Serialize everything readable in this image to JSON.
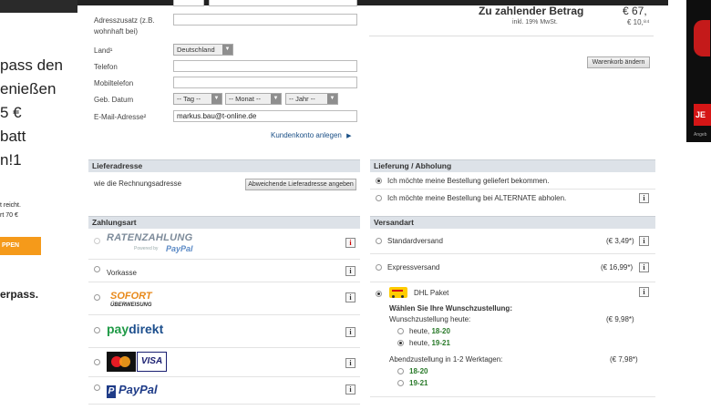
{
  "promo": {
    "lines": [
      "pass den",
      "enießen",
      "5 €",
      "batt",
      "n!1"
    ],
    "small1": "t reicht.",
    "small2": "rt 70 €",
    "button": "PPEN",
    "brand": "erpass."
  },
  "ad": {
    "button": "JE",
    "small": "Angeb"
  },
  "address": {
    "adresszusatz_label": "Adresszusatz (z.B.",
    "adresszusatz_label2": "wohnhaft bei)",
    "land_label": "Land¹",
    "land_value": "Deutschland",
    "telefon_label": "Telefon",
    "mobil_label": "Mobiltelefon",
    "geb_label": "Geb. Datum",
    "tag": "-- Tag --",
    "monat": "-- Monat --",
    "jahr": "-- Jahr --",
    "email_label": "E-Mail-Adresse²",
    "email_value": "markus.bau@t-online.de",
    "konto_link": "Kundenkonto anlegen"
  },
  "summary": {
    "title": "Zu zahlender Betrag",
    "total": "€ 67,",
    "mwst_label": "inkl. 19% MwSt.",
    "mwst_value": "€ 10,⁸⁴",
    "cart_button": "Warenkorb ändern"
  },
  "lieferadresse": {
    "title": "Lieferadresse",
    "text": "wie die Rechnungsadresse",
    "button": "Abweichende Lieferadresse angeben"
  },
  "lieferung": {
    "title": "Lieferung / Abholung",
    "option1": "Ich möchte meine Bestellung geliefert bekommen.",
    "option2": "Ich möchte meine Bestellung bei ALTERNATE abholen."
  },
  "zahlungsart": {
    "title": "Zahlungsart",
    "ratenzahlung": "RATENZAHLUNG",
    "ratenzahlung_sub": "Powered by",
    "ratenzahlung_paypal": "PayPal",
    "vorkasse": "Vorkasse",
    "sofort": "SOFORT",
    "sofort_sub": "ÜBERWEISUNG",
    "paydirekt_pay": "pay",
    "paydirekt_direkt": "direkt",
    "visa": "VISA",
    "paypal": "PayPal"
  },
  "versandart": {
    "title": "Versandart",
    "standard": "Standardversand",
    "standard_price": "(€ 3,49*)",
    "express": "Expressversand",
    "express_price": "(€ 16,99*)",
    "dhl": "DHL Paket",
    "wunsch_title": "Wählen Sie Ihre Wunschzustellung:",
    "wunsch_heute": "Wunschzustellung heute:",
    "wunsch_heute_price": "(€ 9,98*)",
    "heute1_prefix": "heute,",
    "heute1_time": "18-20",
    "heute2_prefix": "heute,",
    "heute2_time": "19-21",
    "abend": "Abendzustellung in 1-2 Werktagen:",
    "abend_price": "(€ 7,98*)",
    "abend1": "18-20",
    "abend2": "19-21"
  },
  "info_glyph": "i"
}
